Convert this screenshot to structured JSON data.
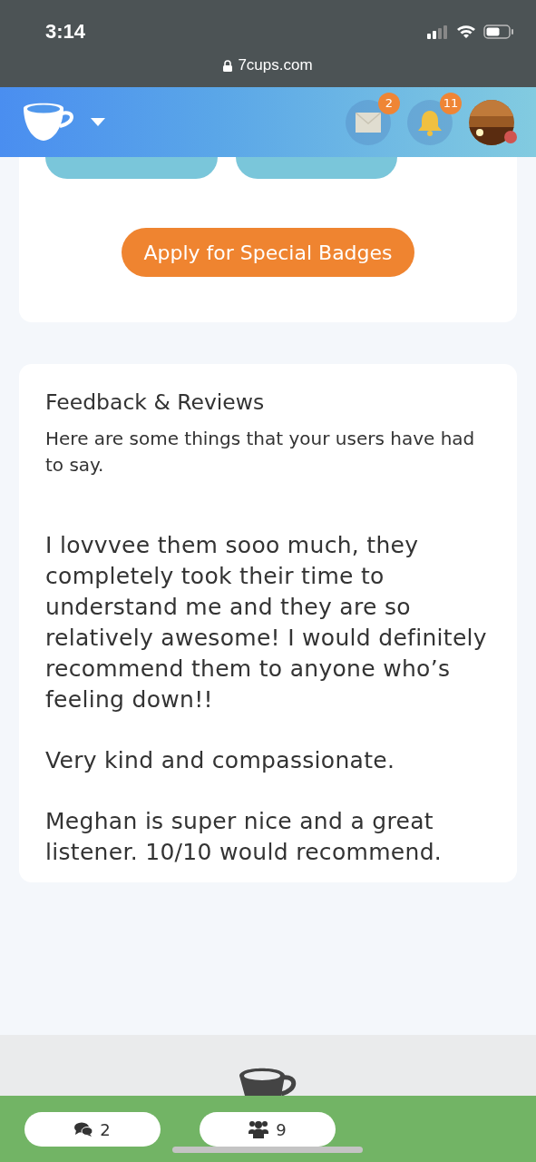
{
  "status_bar": {
    "time": "3:14",
    "url": "7cups.com"
  },
  "header": {
    "message_count": "2",
    "notification_count": "11",
    "online": true
  },
  "badges_card": {
    "badge_pills": [
      {
        "kind": "pill"
      },
      {
        "kind": "pill"
      }
    ],
    "apply_button": "Apply for Special Badges"
  },
  "feedback": {
    "title": "Feedback & Reviews",
    "intro": "Here are some things that your users have had to say.",
    "reviews": [
      "I lovvvee them sooo much, they completely took their time to understand me and they are so relatively awesome! I would definitely recommend them to anyone who’s feeling down!!",
      "Very kind and compassionate.",
      "Meghan is super nice and a great listener. 10/10 would recommend."
    ]
  },
  "bottom_bar": {
    "chats": "2",
    "groups": "9"
  }
}
